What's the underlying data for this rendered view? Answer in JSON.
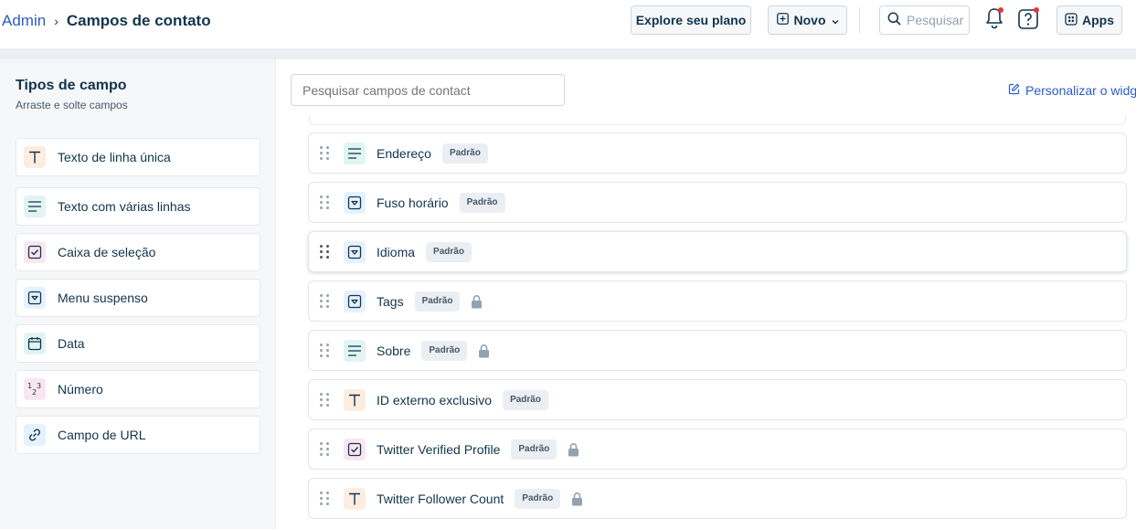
{
  "breadcrumb": {
    "parent": "Admin",
    "separator": "›",
    "current": "Campos de contato"
  },
  "header": {
    "explore_label": "Explore seu plano",
    "new_label": "Novo",
    "search_placeholder": "Pesquisar",
    "apps_label": "Apps"
  },
  "sidebar": {
    "title": "Tipos de campo",
    "subtitle": "Arraste e solte campos",
    "items": [
      {
        "label": "Texto de linha única",
        "icon": "text-icon"
      },
      {
        "label": "Texto com várias linhas",
        "icon": "paragraph-icon"
      },
      {
        "label": "Caixa de seleção",
        "icon": "checkbox-icon"
      },
      {
        "label": "Menu suspenso",
        "icon": "dropdown-icon"
      },
      {
        "label": "Data",
        "icon": "calendar-icon"
      },
      {
        "label": "Número",
        "icon": "number-icon"
      },
      {
        "label": "Campo de URL",
        "icon": "link-icon"
      }
    ]
  },
  "main": {
    "search_placeholder": "Pesquisar campos de contact",
    "customize_label": "Personalizar o widg",
    "fields": [
      {
        "label": "Endereço",
        "badge": "Padrão",
        "icon": "paragraph-icon",
        "locked": false
      },
      {
        "label": "Fuso horário",
        "badge": "Padrão",
        "icon": "dropdown-icon",
        "locked": false
      },
      {
        "label": "Idioma",
        "badge": "Padrão",
        "icon": "dropdown-icon",
        "locked": false
      },
      {
        "label": "Tags",
        "badge": "Padrão",
        "icon": "dropdown-icon",
        "locked": true
      },
      {
        "label": "Sobre",
        "badge": "Padrão",
        "icon": "paragraph-icon",
        "locked": true
      },
      {
        "label": "ID externo exclusivo",
        "badge": "Padrão",
        "icon": "text-icon",
        "locked": false
      },
      {
        "label": "Twitter Verified Profile",
        "badge": "Padrão",
        "icon": "checkbox-icon",
        "locked": true
      },
      {
        "label": "Twitter Follower Count",
        "badge": "Padrão",
        "icon": "text-icon",
        "locked": true
      }
    ]
  },
  "colors": {
    "accent": "#2c5cc5",
    "notification_dot": "#e43538",
    "text_icon_bg": "#fdede0",
    "paragraph_icon_bg": "#e0f5f1",
    "checkbox_icon_bg": "#fbe6ef",
    "dropdown_icon_bg": "#e5f2fd",
    "badge_bg": "#ebeff3"
  }
}
